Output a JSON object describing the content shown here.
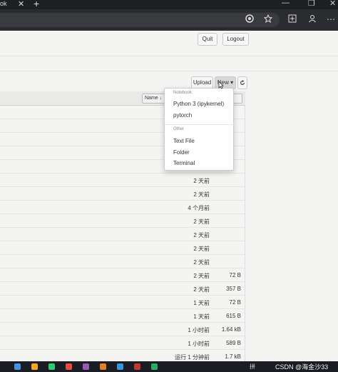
{
  "browser": {
    "tab_title": "ok",
    "tab_close": "✕",
    "new_tab": "+",
    "min_icon": "—",
    "max_icon": "❐",
    "close_icon": "✕",
    "toolbar_icons": [
      "edge-icon",
      "favorite-icon",
      "collections-icon",
      "profile-icon",
      "more-icon"
    ]
  },
  "header": {
    "quit_label": "Quit",
    "logout_label": "Logout"
  },
  "toolbar": {
    "upload_label": "Upload",
    "new_label": "New ▾",
    "refresh_icon": "refresh-icon"
  },
  "list": {
    "name_header": "Name ↓",
    "last_modified_header": "e",
    "rows": [
      {
        "time": "",
        "size": ""
      },
      {
        "time": "",
        "size": ""
      },
      {
        "time": "",
        "size": ""
      },
      {
        "time": "",
        "size": ""
      },
      {
        "time": "",
        "size": ""
      },
      {
        "time": "2 天前",
        "size": ""
      },
      {
        "time": "2 天前",
        "size": ""
      },
      {
        "time": "4 个月前",
        "size": ""
      },
      {
        "time": "2 天前",
        "size": ""
      },
      {
        "time": "2 天前",
        "size": ""
      },
      {
        "time": "2 天前",
        "size": ""
      },
      {
        "time": "2 天前",
        "size": ""
      },
      {
        "time": "2 天前",
        "size": "72 B"
      },
      {
        "time": "2 天前",
        "size": "357 B"
      },
      {
        "time": "1 天前",
        "size": "72 B"
      },
      {
        "time": "1 天前",
        "size": "615 B"
      },
      {
        "time": "1 小时前",
        "size": "1.64 kB"
      },
      {
        "time": "1 小时前",
        "size": "589 B"
      },
      {
        "time": "运行 1 分钟前",
        "size": "1.7 kB"
      }
    ]
  },
  "dropdown": {
    "notebook_header": "Notebook:",
    "notebook_items": [
      "Python 3 (ipykernel)",
      "pytorch"
    ],
    "other_header": "Other",
    "other_items": [
      "Text File",
      "Folder",
      "Terminal"
    ]
  },
  "taskbar": {
    "watermark": "CSDN @海金沙33",
    "tray_text": "拼",
    "icon_colors": [
      "#4a90e2",
      "#f5a623",
      "#2ecc71",
      "#e74c3c",
      "#9b59b6",
      "#e67e22",
      "#3498db",
      "#c0392b",
      "#27ae60"
    ]
  }
}
